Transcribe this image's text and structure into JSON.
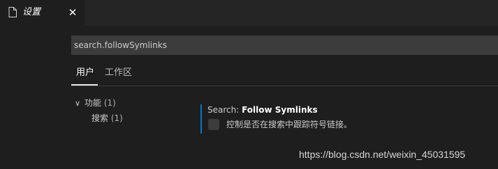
{
  "tabbar": {
    "tab": {
      "icon": "file-icon",
      "label": "设置",
      "close_icon": "✕"
    }
  },
  "search": {
    "value": "search.followSymlinks"
  },
  "scope_tabs": {
    "user": "用户",
    "workspace": "工作区"
  },
  "toc": {
    "group": {
      "chevron": "∨",
      "label": "功能",
      "count": "(1)"
    },
    "child": {
      "label": "搜索",
      "count": "(1)"
    }
  },
  "setting": {
    "category": "Search: ",
    "name": "Follow Symlinks",
    "description": "控制是否在搜索中跟踪符号链接。",
    "checked": false
  },
  "watermark": "https://blog.csdn.net/weixin_45031595",
  "colors": {
    "background": "#1e1e1e",
    "tabbar": "#252526",
    "accent_border": "#007acc",
    "input_bg": "#3c3c3c"
  }
}
